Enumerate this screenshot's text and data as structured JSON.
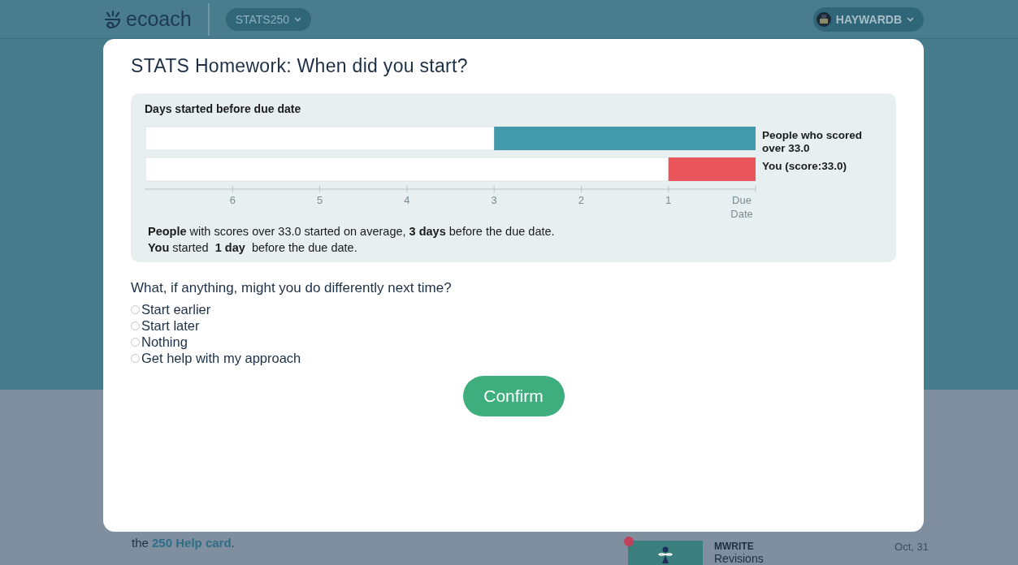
{
  "header": {
    "logo": "ecoach",
    "course": "STATS250",
    "user": "HAYWARDB"
  },
  "modal": {
    "title": "STATS Homework: When did you start?",
    "chart_panel": {
      "chart_data": {
        "type": "bar",
        "orientation": "horizontal",
        "title": "Days started before due date",
        "categories": [
          "People who scored over 33.0",
          "You (score:33.0)"
        ],
        "series": [
          {
            "color": "#4299ac",
            "values": [
              3,
              null
            ]
          },
          {
            "color": "#ea555b",
            "values": [
              null,
              1
            ]
          }
        ],
        "xlim": [
          7,
          0
        ],
        "xticks": [
          {
            "value": 6,
            "label": "6"
          },
          {
            "value": 5,
            "label": "5"
          },
          {
            "value": 4,
            "label": "4"
          },
          {
            "value": 3,
            "label": "3"
          },
          {
            "value": 2,
            "label": "2"
          },
          {
            "value": 1,
            "label": "1"
          },
          {
            "value": 0,
            "label": "Due Date"
          }
        ]
      },
      "summary": [
        "**People** with scores over 33.0 started on average, **3 days** before the due date.",
        "**You** started  **1 day**  before the due date."
      ]
    },
    "question": "What, if anything, might you do differently next time?",
    "options": [
      {
        "label": "Start earlier",
        "selected": false
      },
      {
        "label": "Start later",
        "selected": false
      },
      {
        "label": "Nothing",
        "selected": false
      },
      {
        "label": "Get help with my approach",
        "selected": false
      }
    ],
    "confirm": "Confirm"
  },
  "background": {
    "help_before": "the ",
    "help_link": "250 Help card",
    "help_after": ".",
    "card": {
      "title": "MWRITE",
      "subtitle": "Revisions",
      "date": "Oct, 31",
      "unread": true
    }
  }
}
